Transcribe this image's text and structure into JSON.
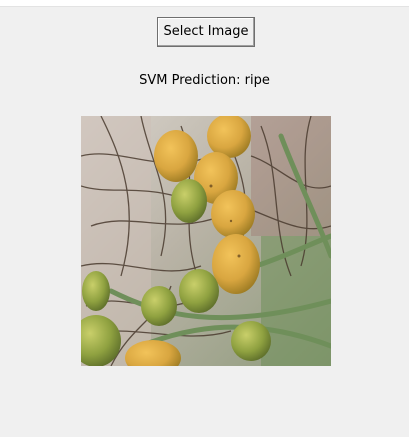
{
  "window": {
    "background": "#f0f0f0"
  },
  "controls": {
    "select_image_label": "Select Image"
  },
  "result": {
    "prediction_text": "SVM Prediction: ripe"
  },
  "image_panel": {
    "subject": "palm-fruit-cluster-photo",
    "colors": {
      "fruit": "#d9a640",
      "fruit_green": "#8fa140",
      "branch": "#5b4a3a",
      "foliage": "#6f8f5a",
      "background": "#c9c2b8"
    }
  }
}
